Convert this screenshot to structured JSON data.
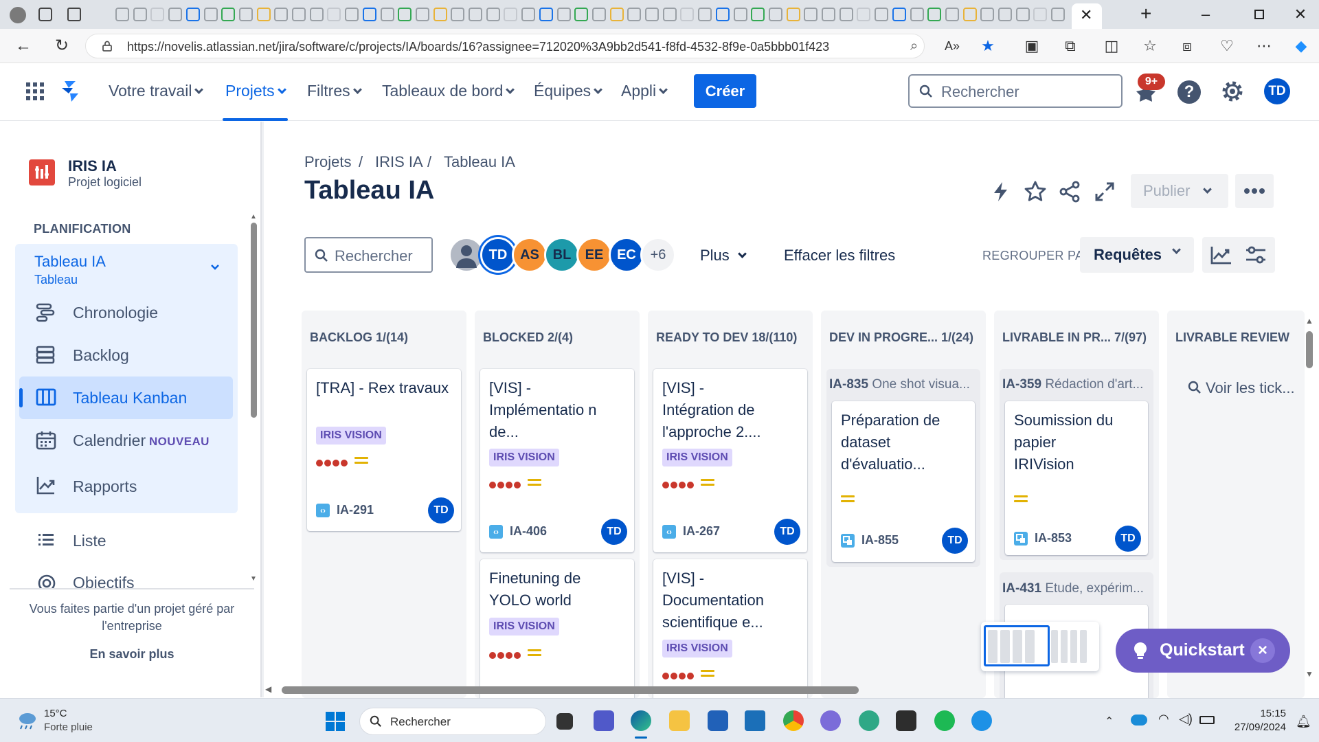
{
  "browser": {
    "url": "https://novelis.atlassian.net/jira/software/c/projects/IA/boards/16?assignee=712020%3A9bb2d541-f8fd-4532-8f9e-0a5bbb01f423"
  },
  "topnav": {
    "items": [
      {
        "label": "Votre travail"
      },
      {
        "label": "Projets"
      },
      {
        "label": "Filtres"
      },
      {
        "label": "Tableaux de bord"
      },
      {
        "label": "Équipes"
      },
      {
        "label": "Appli"
      }
    ],
    "create_label": "Créer",
    "search_placeholder": "Rechercher",
    "notif_badge": "9+",
    "user_initials": "TD"
  },
  "sidebar": {
    "project_name": "IRIS IA",
    "project_type": "Projet logiciel",
    "section": "PLANIFICATION",
    "board_name": "Tableau IA",
    "board_type": "Tableau",
    "items": [
      {
        "label": "Chronologie",
        "icon": "timeline-icon"
      },
      {
        "label": "Backlog",
        "icon": "backlog-icon"
      },
      {
        "label": "Tableau Kanban",
        "icon": "board-icon"
      },
      {
        "label": "Calendrier",
        "icon": "calendar-icon",
        "badge": "NOUVEAU"
      },
      {
        "label": "Rapports",
        "icon": "chart-icon"
      },
      {
        "label": "Liste",
        "icon": "list-icon"
      },
      {
        "label": "Objectifs",
        "icon": "goal-icon"
      }
    ],
    "footer_text": "Vous faites partie d'un projet géré par l'entreprise",
    "footer_link": "En savoir plus"
  },
  "main": {
    "breadcrumbs": [
      "Projets",
      "IRIS IA",
      "Tableau IA"
    ],
    "separator": "/",
    "title": "Tableau IA",
    "publish_label": "Publier",
    "search_placeholder": "Rechercher",
    "avatars": [
      "TD",
      "AS",
      "BL",
      "EE",
      "EC"
    ],
    "avatar_more": "+6",
    "more_filters": "Plus",
    "clear_filters": "Effacer les filtres",
    "group_by_label": "REGROUPER PAR",
    "group_by_value": "Requêtes"
  },
  "columns": [
    {
      "title": "BACKLOG 1/(14)"
    },
    {
      "title": "BLOCKED 2/(4)"
    },
    {
      "title": "READY TO DEV 18/(110)"
    },
    {
      "title": "DEV IN PROGRE... 1/(24)"
    },
    {
      "title": "LIVRABLE IN PR... 7/(97)"
    },
    {
      "title": "LIVRABLE REVIEW"
    }
  ],
  "cards": {
    "c1": {
      "title": "[TRA] - Rex travaux",
      "label": "IRIS VISION",
      "key": "IA-291",
      "assignee": "TD"
    },
    "c2": {
      "title": "[VIS] - Implémentatio n de...",
      "label": "IRIS VISION",
      "key": "IA-406",
      "assignee": "TD"
    },
    "c3": {
      "title": "Finetuning de YOLO world",
      "label": "IRIS VISION"
    },
    "c4": {
      "title": "[VIS] - Intégration de l'approche 2....",
      "label": "IRIS VISION",
      "key": "IA-267",
      "assignee": "TD"
    },
    "c5": {
      "title": "[VIS] - Documentation scientifique e...",
      "label": "IRIS VISION"
    },
    "p1": {
      "key": "IA-835",
      "summary": "One shot visua..."
    },
    "c6": {
      "title": "Préparation de dataset d'évaluatio...",
      "key": "IA-855",
      "assignee": "TD"
    },
    "p2": {
      "key": "IA-359",
      "summary": "Rédaction d'art..."
    },
    "c7": {
      "title": "Soumission du papier IRIVision",
      "key": "IA-853",
      "assignee": "TD"
    },
    "p3": {
      "key": "IA-431",
      "summary": "Etude, expérim..."
    },
    "review_link": "Voir les tick..."
  },
  "quickstart": {
    "label": "Quickstart",
    "close": "×"
  },
  "taskbar": {
    "weather_temp": "15°C",
    "weather_desc": "Forte pluie",
    "search_placeholder": "Rechercher",
    "time": "15:15",
    "date": "27/09/2024"
  },
  "colors": {
    "accent": "#0c66e4",
    "label_bg": "#dfd8fd",
    "label_text": "#5e4db2",
    "priority_high": "#c9372c",
    "priority_medium": "#e2b203",
    "quickstart": "#6e5dc6"
  }
}
